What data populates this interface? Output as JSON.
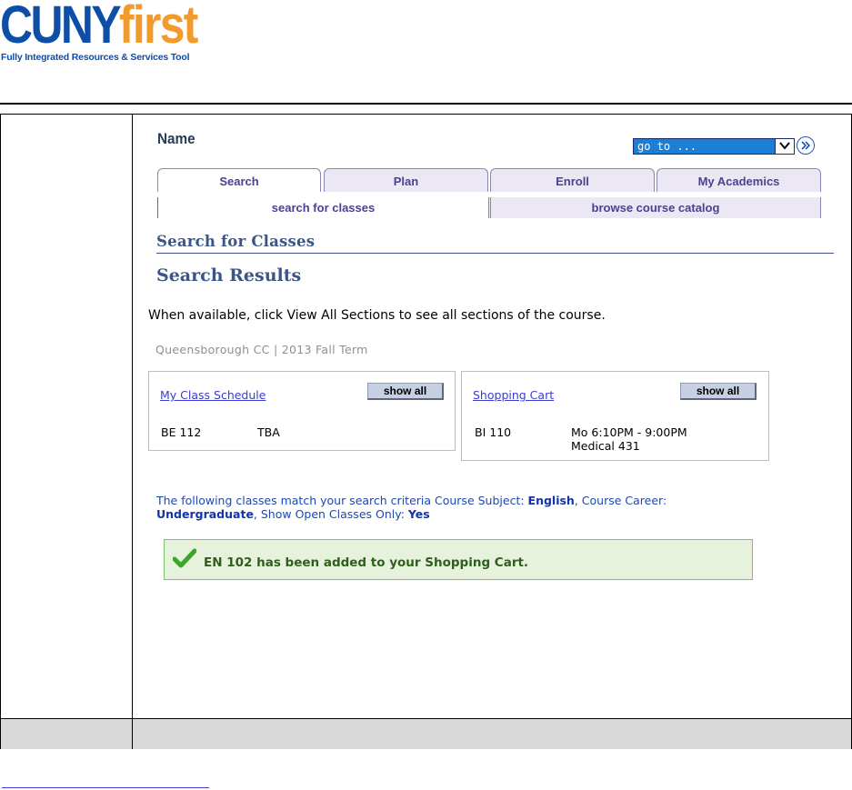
{
  "logo": {
    "brand_main": "CUNY",
    "brand_accent": "first",
    "tagline": "Fully Integrated Resources & Services Tool"
  },
  "header": {
    "name_label": "Name"
  },
  "goto": {
    "value": "go to ...",
    "arrow_icon": "chevron-down-icon",
    "go_icon": "double-chevron-right-icon"
  },
  "tabs": [
    {
      "label": "Search",
      "active": true
    },
    {
      "label": "Plan",
      "active": false
    },
    {
      "label": "Enroll",
      "active": false
    },
    {
      "label": "My Academics",
      "active": false
    }
  ],
  "subtabs": [
    {
      "label": "search for classes",
      "active": true
    },
    {
      "label": "browse course catalog",
      "active": false
    }
  ],
  "page": {
    "section_title": "Search for Classes",
    "results_title": "Search Results",
    "instruction": "When available, click View All Sections to see all sections of the course.",
    "term": "Queensborough CC | 2013 Fall Term"
  },
  "schedule_box": {
    "link": "My Class Schedule",
    "button": "show all",
    "rows": [
      {
        "course": "BE 112",
        "time": "TBA"
      }
    ]
  },
  "cart_box": {
    "link": "Shopping Cart",
    "button": "show all",
    "rows": [
      {
        "course": "BI 110",
        "time": "Mo 6:10PM - 9:00PM",
        "room": "Medical 431"
      }
    ]
  },
  "criteria": {
    "prefix": "The following classes match your search criteria Course Subject: ",
    "subject": "English",
    "career_label": ",  Course Career: ",
    "career": "Undergraduate",
    "open_label": ",  Show Open Classes Only: ",
    "open": "Yes"
  },
  "message": {
    "icon": "checkmark-icon",
    "text": "EN  102 has been added to your Shopping Cart."
  },
  "colors": {
    "brand_blue": "#0d4ea6",
    "brand_orange": "#f39a2c",
    "success_bg": "#e6f2dc",
    "heading": "#3b5586"
  }
}
